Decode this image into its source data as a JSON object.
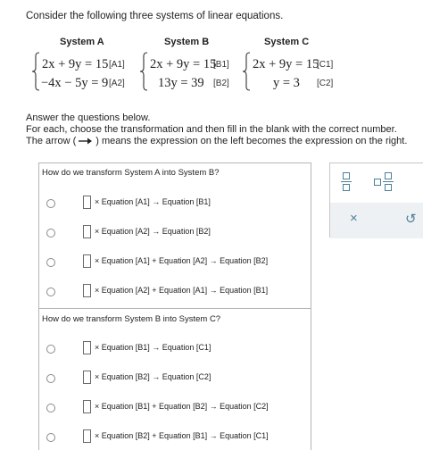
{
  "intro": "Consider the following three systems of linear equations.",
  "systems": [
    {
      "title": "System A",
      "eq1": "2x + 9y = 15",
      "tag1": "[A1]",
      "eq2": "−4x − 5y = 9",
      "tag2": "[A2]"
    },
    {
      "title": "System B",
      "eq1": "2x + 9y = 15",
      "tag1": "[B1]",
      "eq2": "13y = 39",
      "tag2": "[B2]"
    },
    {
      "title": "System C",
      "eq1": "2x + 9y = 15",
      "tag1": "[C1]",
      "eq2": "y = 3",
      "tag2": "[C2]"
    }
  ],
  "answer": {
    "line1": "Answer the questions below.",
    "line2": "For each, choose the transformation and then fill in the blank with the correct number.",
    "line3_pre": "The arrow (",
    "line3_post": ") means the expression on the left becomes the expression on the right."
  },
  "questions": [
    {
      "prompt": "How do we transform System A into System B?",
      "options": [
        "× Equation [A1] → Equation [B1]",
        "× Equation [A2] → Equation [B2]",
        "× Equation [A1] + Equation [A2] → Equation [B2]",
        "× Equation [A2] + Equation [A1] → Equation [B1]"
      ]
    },
    {
      "prompt": "How do we transform System B into System C?",
      "options": [
        "× Equation [B1] → Equation [C1]",
        "× Equation [B2] → Equation [C2]",
        "× Equation [B1] + Equation [B2] → Equation [C2]",
        "× Equation [B2] + Equation [B1] → Equation [C1]"
      ]
    }
  ],
  "tools": {
    "clear_label": "×",
    "undo_label": "↺"
  },
  "colors": {
    "accent": "#4d7f9a",
    "border": "#b5b5b5",
    "tool_bg": "#eef1f3"
  }
}
